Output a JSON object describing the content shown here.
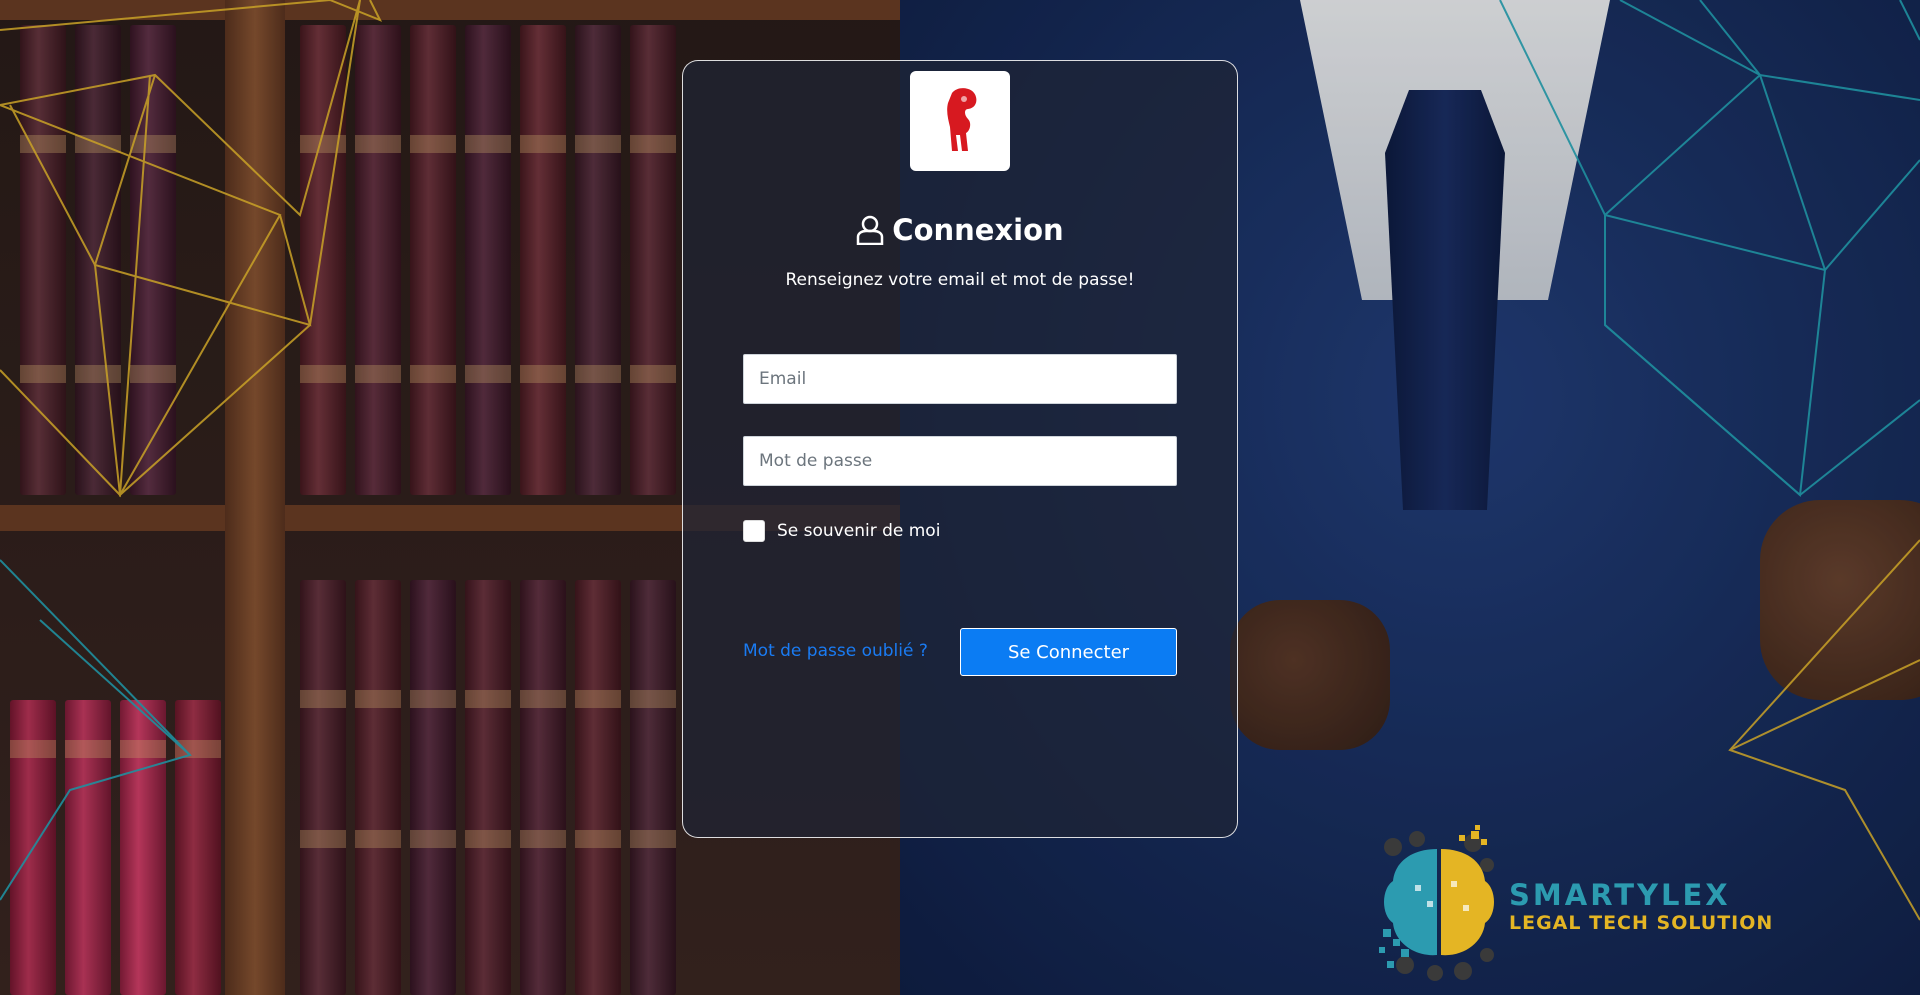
{
  "login": {
    "title": "Connexion",
    "subtitle": "Renseignez votre email et mot de passe!",
    "email_placeholder": "Email",
    "email_value": "",
    "password_placeholder": "Mot de passe",
    "password_value": "",
    "remember_label": "Se souvenir de moi",
    "remember_checked": false,
    "forgot_label": "Mot de passe oublié ?",
    "submit_label": "Se Connecter"
  },
  "brand": {
    "name": "SMARTYLEX",
    "tagline": "LEGAL TECH SOLUTION"
  },
  "icons": {
    "title_icon": "user-icon",
    "card_logo": "red-horse-knight-logo"
  },
  "colors": {
    "accent": "#0b7cf3",
    "link": "#1a7bf2",
    "brand_teal": "#2c9bb0",
    "brand_gold": "#e4b524",
    "logo_red": "#d71920"
  }
}
